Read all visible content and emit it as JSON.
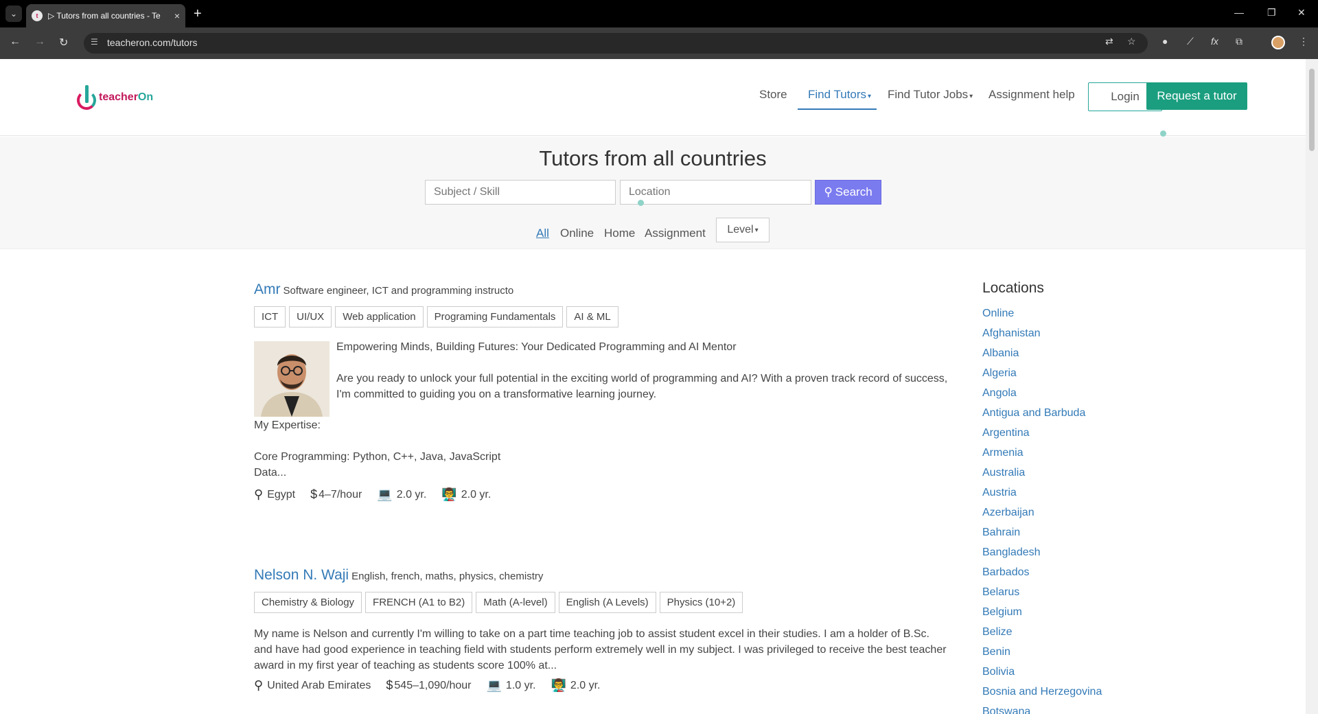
{
  "browser": {
    "tab_title": "▷ Tutors from all countries - Te",
    "url": "teacheron.com/tutors",
    "new_tab": "+",
    "tab_close": "×"
  },
  "site": {
    "logo_a": "teacher",
    "logo_b": "On",
    "nav": {
      "store": "Store",
      "find_tutors": "Find Tutors",
      "find_tutor_jobs": "Find Tutor Jobs",
      "assignment_help": "Assignment help",
      "login": "Login",
      "request": "Request a tutor"
    }
  },
  "hero": {
    "title": "Tutors from all countries",
    "subject_placeholder": "Subject / Skill",
    "location_placeholder": "Location",
    "search_label": "Search",
    "filters": [
      "All",
      "Online",
      "Home",
      "Assignment"
    ],
    "level_label": "Level"
  },
  "tutors": [
    {
      "name": "Amr",
      "headline": "Software engineer, ICT and programming instructo",
      "tags": [
        "ICT",
        "UI/UX",
        "Web application",
        "Programing Fundamentals",
        "AI & ML"
      ],
      "intro": "Empowering Minds, Building Futures: Your Dedicated Programming and AI Mentor",
      "para1": "Are you ready to unlock your full potential in the exciting world of programming and AI? With a proven track record of success, I'm committed to guiding you on a transformative learning journey.",
      "expertise": "My Expertise:",
      "core": "Core Programming: Python, C++, Java, JavaScript",
      "data": "Data...",
      "country": "Egypt",
      "rate": "4–7/hour",
      "online_exp": "2.0 yr.",
      "teaching_exp": "2.0 yr."
    },
    {
      "name": "Nelson N. Waji",
      "headline": "English, french, maths, physics, chemistry",
      "tags": [
        "Chemistry & Biology",
        "FRENCH (A1 to B2)",
        "Math (A-level)",
        "English (A Levels)",
        "Physics (10+2)"
      ],
      "para1": "My name is Nelson and currently I'm willing to take on a part time teaching job to assist student excel in their studies. I am a holder of B.Sc. and have had good experience in teaching field with students perform extremely well in my subject. I was privileged to receive the best teacher award in my first year of teaching as students score 100% at...",
      "country": "United Arab Emirates",
      "rate": "545–1,090/hour",
      "online_exp": "1.0 yr.",
      "teaching_exp": "2.0 yr."
    }
  ],
  "sidebar": {
    "title": "Locations",
    "locations": [
      "Online",
      "Afghanistan",
      "Albania",
      "Algeria",
      "Angola",
      "Antigua and Barbuda",
      "Argentina",
      "Armenia",
      "Australia",
      "Austria",
      "Azerbaijan",
      "Bahrain",
      "Bangladesh",
      "Barbados",
      "Belarus",
      "Belgium",
      "Belize",
      "Benin",
      "Bolivia",
      "Bosnia and Herzegovina",
      "Botswana"
    ]
  },
  "colors": {
    "accent": "#337ab7",
    "brand_green": "#1a9e7f",
    "search_btn": "#7b7bf0"
  }
}
